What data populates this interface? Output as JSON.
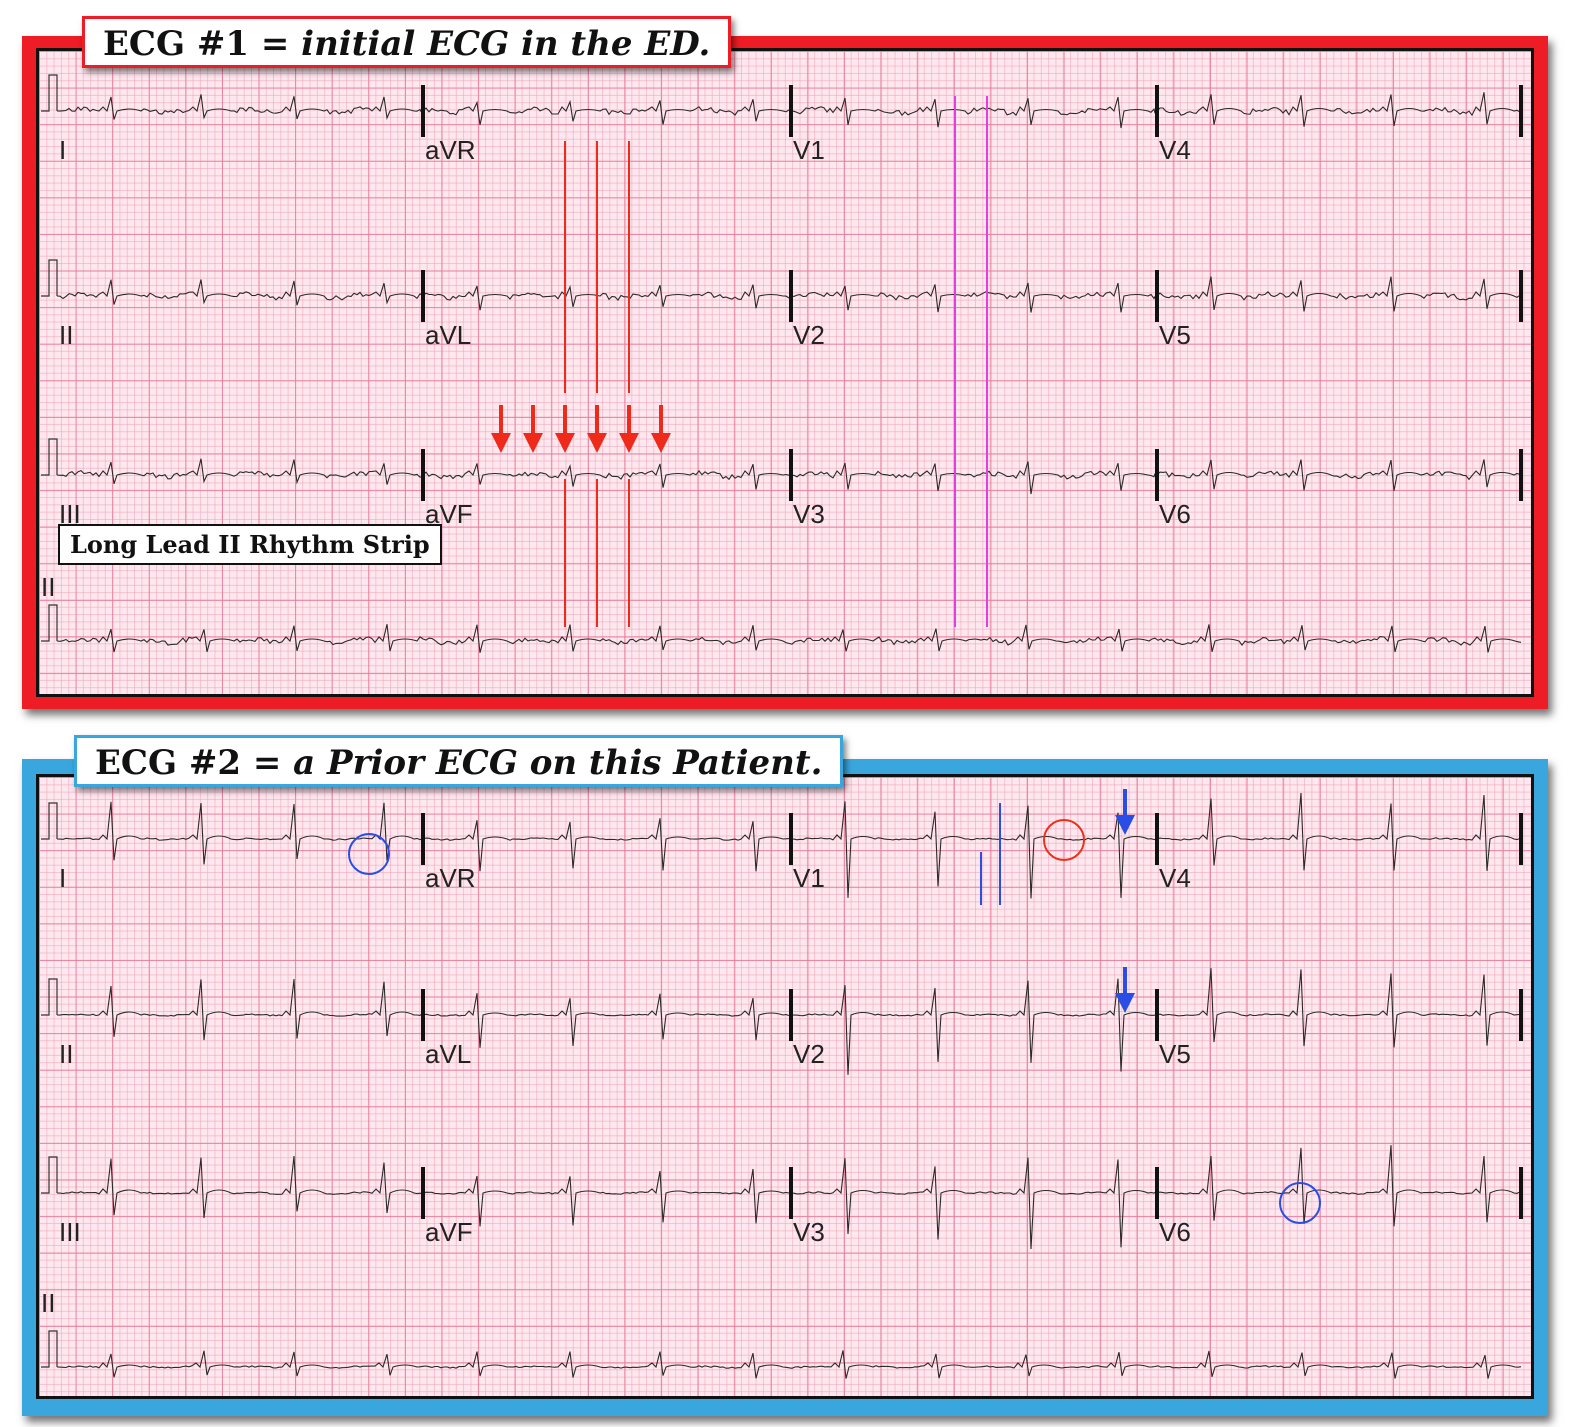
{
  "ecg1": {
    "title_prefix": "ECG #1 = ",
    "title_italic": "initial ECG in the ED.",
    "strip_note": "Long Lead II Rhythm Strip",
    "border_color": "#ee1c24",
    "leads": [
      "I",
      "aVR",
      "V1",
      "V4",
      "II",
      "aVL",
      "V2",
      "V5",
      "III",
      "aVF",
      "V3",
      "V6",
      "II"
    ],
    "annotations": {
      "arrow_color": "#ee2a1a",
      "red_arrow_count": 6,
      "red_vertical_line_count": 3,
      "magenta_vertical_line_count": 2,
      "magenta_color": "#e040e0"
    }
  },
  "ecg2": {
    "title_prefix": "ECG #2 = ",
    "title_italic": "a Prior ECG on this Patient.",
    "border_color": "#39a7de",
    "leads": [
      "I",
      "aVR",
      "V1",
      "V4",
      "II",
      "aVL",
      "V2",
      "V5",
      "III",
      "aVF",
      "V3",
      "V6",
      "II"
    ],
    "annotations": {
      "blue_arrow_count": 2,
      "blue_circle_count": 2,
      "red_circle_count": 1,
      "blue_vertical_line_count": 2,
      "blue_color": "#2a4de6",
      "red_circle_color": "#e8331c"
    }
  }
}
